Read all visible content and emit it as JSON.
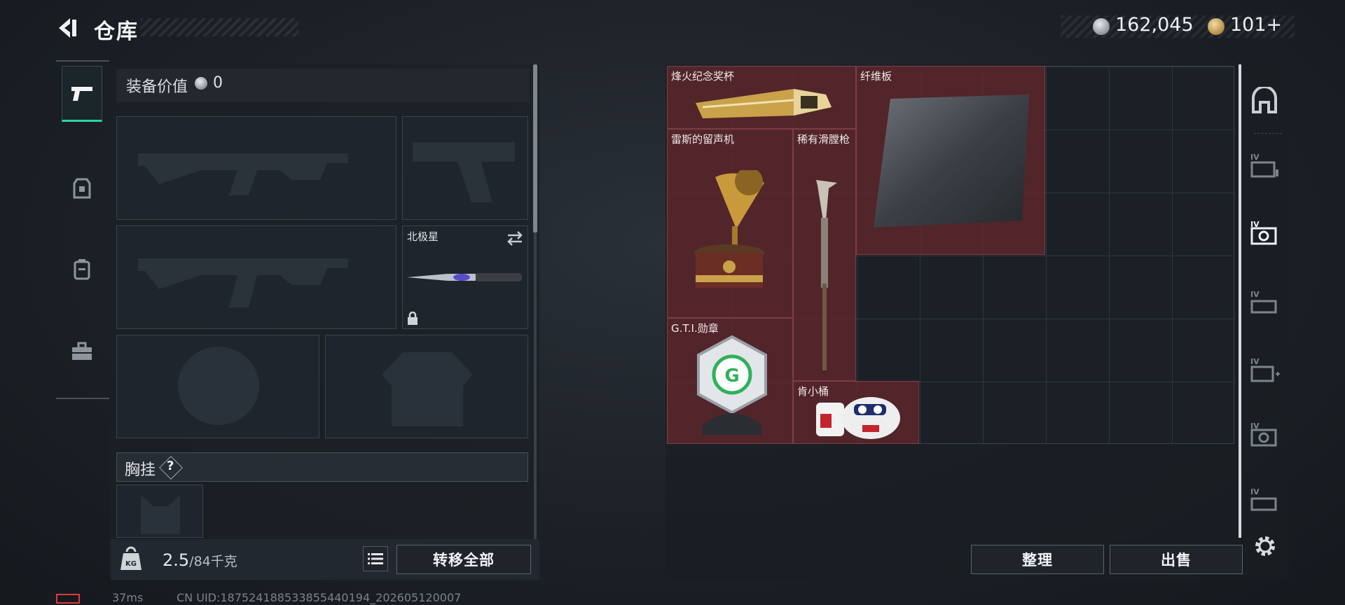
{
  "header": {
    "title": "仓库",
    "currency_silver": "162,045",
    "currency_gold": "101+"
  },
  "equipment": {
    "value_label": "装备价值",
    "value": "0",
    "melee_slot_label": "北极星",
    "chest_rig_label": "胸挂",
    "chest_help": "?"
  },
  "footer_left": {
    "weight_current": "2.5",
    "weight_max": "/84千克",
    "transfer_all": "转移全部"
  },
  "stash": {
    "items": [
      {
        "name": "烽火纪念奖杯"
      },
      {
        "name": "纤维板"
      },
      {
        "name": "雷斯的留声机"
      },
      {
        "name": "稀有滑膛枪"
      },
      {
        "name": "G.T.I.勋章"
      },
      {
        "name": "肯小桶"
      }
    ],
    "sort_label": "整理",
    "sell_label": "出售"
  },
  "status": {
    "ping": "37ms",
    "uid": "CN UID:18752418853385544019​4_202605120007"
  },
  "colors": {
    "accent": "#2fd1a8",
    "item_bg": "#62262c",
    "battery": "#e03a3a"
  }
}
